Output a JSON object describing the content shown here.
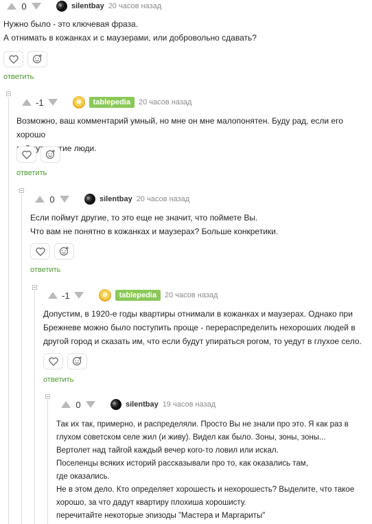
{
  "comments": [
    {
      "score": "0",
      "author": "silentbay",
      "time": "20 часов назад",
      "lines": [
        "Нужно было - это ключевая фраза.",
        "А отнимать в кожанках и с маузерами, или добровольно сдавать?"
      ],
      "reply": "ответить"
    },
    {
      "score": "-1",
      "author": "tablepedia",
      "time": "20 часов назад",
      "lines": [
        "Возможно, ваш комментарий умный, но мне он мне малопонятен. Буду рад, если его хорошо",
        "поймут другие люди."
      ],
      "reply": "ответить"
    },
    {
      "score": "0",
      "author": "silentbay",
      "time": "20 часов назад",
      "lines": [
        "Если поймут другие, то это еще не значит, что поймете Вы.",
        "Что вам не понятно в кожанках и маузерах? Больше конкретики."
      ],
      "reply": "ответить"
    },
    {
      "score": "-1",
      "author": "tablepedia",
      "time": "20 часов назад",
      "lines": [
        "Допустим, в 1920-е годы квартиры отнимали в кожанках и маузерах. Однако при",
        "Брежневе можно было поступить проще - перераспределить нехороших людей в",
        "другой город и сказать им, что если будут упираться рогом, то уедут в глухое село."
      ],
      "reply": "ответить"
    },
    {
      "score": "0",
      "author": "silentbay",
      "time": "19 часов назад",
      "lines": [
        "Так их так, примерно, и распределяли. Просто Вы не знали про это. Я как раз в",
        "глухом советском селе жил (и живу). Видел как было. Зоны, зоны, зоны...",
        "Вертолет над тайгой каждый вечер кого-то ловил или искал.",
        "Поселенцы всяких историй рассказывали про то, как оказались там,",
        "где оказались.",
        "Не в этом дело. Кто определяет хорошесть и нехорошесть? Выделите, что такое",
        "хорошо, за что дадут квартиру плохиша хорошисту.",
        "перечитайте некоторые эпизоды \"Мастера и Маргариты\""
      ]
    }
  ],
  "icons": [
    "heart-icon",
    "smiley-plus-icon",
    "arrow-up-icon",
    "arrow-down-icon",
    "collapse-icon"
  ],
  "colors": {
    "reply": "#4c9a2f",
    "badge": "#8ac858",
    "thread-line": "#dcdcdc"
  }
}
